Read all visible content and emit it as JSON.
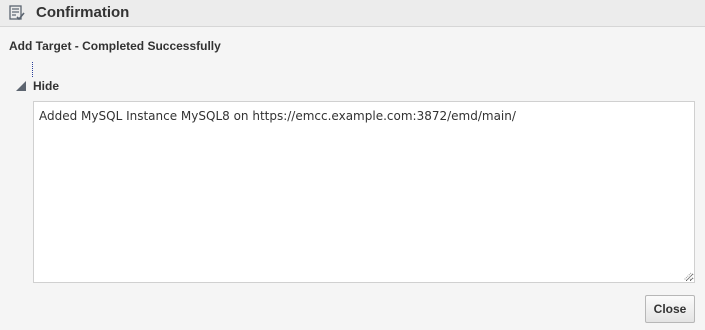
{
  "dialog": {
    "title": "Confirmation",
    "title_icon": "checklist-icon",
    "subtitle": "Add Target - Completed Successfully"
  },
  "details": {
    "toggle_label": "Hide",
    "toggle_icon": "triangle-expanded-icon",
    "message": "Added MySQL Instance MySQL8 on https://emcc.example.com:3872/emd/main/"
  },
  "actions": {
    "close_label": "Close"
  }
}
